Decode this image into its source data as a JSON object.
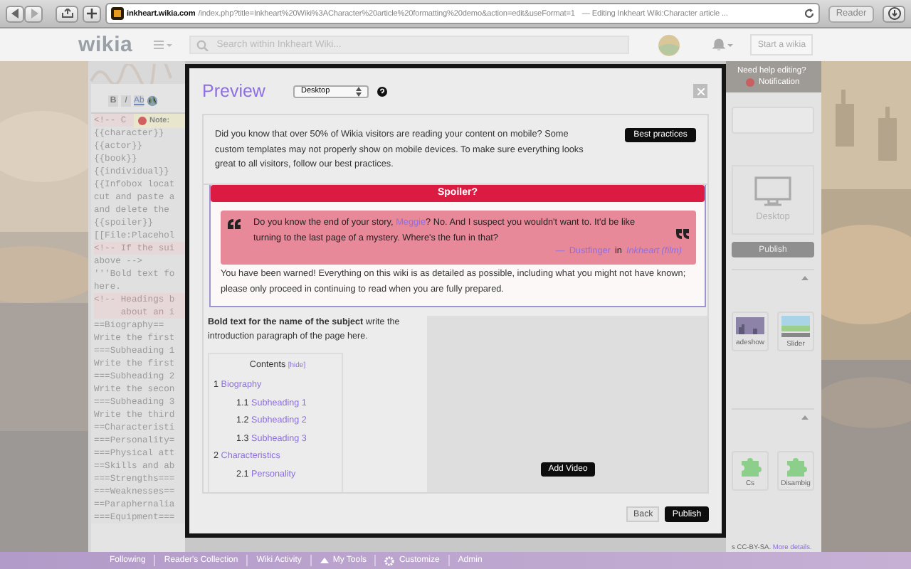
{
  "browser": {
    "url_host": "inkheart.wikia.com",
    "url_path": "/index.php?title=Inkheart%20Wiki%3ACharacter%20article%20formatting%20demo&action=edit&useFormat=1",
    "page_title": "— Editing Inkheart Wiki:Character article ...",
    "reader_button": "Reader"
  },
  "site_header": {
    "logo": "wikia",
    "search_placeholder": "Search within Inkheart Wiki...",
    "start_button": "Start a wikia"
  },
  "editor": {
    "toolbar": [
      "B",
      "I",
      "Ab"
    ],
    "note": "Note:",
    "code_lines": [
      "<!-- C",
      "{{character}}",
      "{{actor}}",
      "{{book}}",
      "{{individual}}",
      "{{Infobox locat",
      "cut and paste a",
      "and delete the",
      "{{spoiler}}",
      "[[File:Placehol",
      "<!-- If the sui",
      "above -->",
      "'''Bold text fo",
      "here.",
      "<!-- Headings b",
      "     about an i",
      "==Biography==",
      "Write the first",
      "===Subheading 1",
      "Write the first",
      "===Subheading 2",
      "Write the secon",
      "===Subheading 3",
      "Write the third",
      "==Characteristi",
      "===Personality=",
      "===Physical att",
      "==Skills and ab",
      "===Strengths===",
      "===Weaknesses==",
      "==Paraphernalia",
      "===Equipment==="
    ]
  },
  "preview_modal": {
    "title": "Preview",
    "device_select": "Desktop",
    "notice": {
      "text": "Did you know that over 50% of Wikia visitors are reading your content on mobile? Some custom templates may not properly show on mobile devices. To make sure everything looks great to all visitors, follow our best practices.",
      "button": "Best practices"
    },
    "spoiler": {
      "title": "Spoiler?",
      "quote_before": "Do you know the end of your story, ",
      "quote_link": "Meggie",
      "quote_after": "? No. And I suspect you wouldn't want to. It'd be like turning to the last page of a mystery. Where's the fun in that?",
      "dash": "—",
      "speaker": "Dustfinger",
      "in": "in",
      "work": "Inkheart (film)",
      "warning": "You have been warned! Everything on this wiki is as detailed as possible, including what you might not have known; please only proceed in continuing to read when you are fully prepared."
    },
    "intro": "**Bold text for the name of the subject** write the introduction paragraph of the page here.",
    "toc": {
      "title": "Contents",
      "toggle": "[hide]",
      "entries": [
        {
          "number": "1",
          "label": "Biography",
          "children": [
            {
              "number": "1.1",
              "label": "Subheading 1"
            },
            {
              "number": "1.2",
              "label": "Subheading 2"
            },
            {
              "number": "1.3",
              "label": "Subheading 3"
            }
          ]
        },
        {
          "number": "2",
          "label": "Characteristics",
          "children": [
            {
              "number": "2.1",
              "label": "Personality"
            }
          ]
        }
      ]
    },
    "video_button": "Add Video",
    "buttons": [
      {
        "label": "Back",
        "primary": false
      },
      {
        "label": "Publish",
        "primary": true
      }
    ]
  },
  "sidebar": {
    "help": "Need help editing?",
    "notification": "Notification",
    "device_label": "Desktop",
    "publish": "Publish",
    "modules": [
      {
        "items": [
          {
            "label": "adeshow",
            "kind": "slideshow"
          },
          {
            "label": "Slider",
            "kind": "slider"
          }
        ]
      },
      {
        "items": [
          {
            "label": "Cs",
            "kind": "puzzle"
          },
          {
            "label": "Disambig",
            "kind": "puzzle"
          }
        ]
      }
    ],
    "license": "s CC-BY-SA.",
    "license_link": "More details."
  },
  "bottom_bar": [
    {
      "label": "Following",
      "kind": "plain"
    },
    {
      "label": "Reader's Collection",
      "kind": "plain"
    },
    {
      "label": "Wiki Activity",
      "kind": "plain"
    },
    {
      "label": "My Tools",
      "kind": "tools"
    },
    {
      "label": "Customize",
      "kind": "gear"
    },
    {
      "label": "Admin",
      "kind": "plain"
    }
  ]
}
